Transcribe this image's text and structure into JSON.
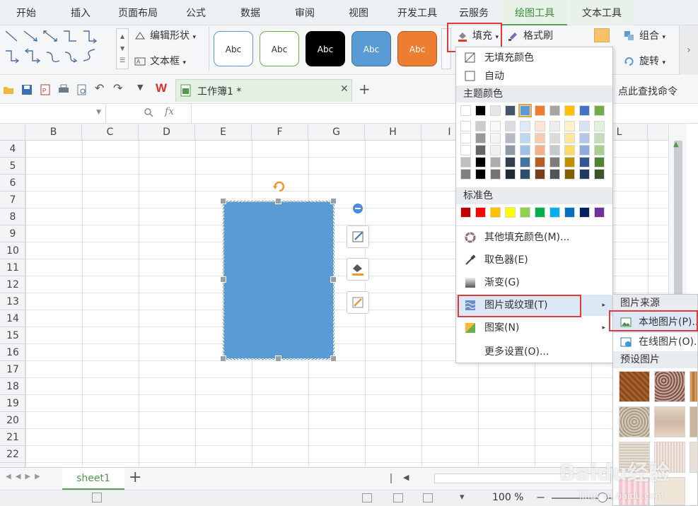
{
  "tabs": [
    "开始",
    "插入",
    "页面布局",
    "公式",
    "数据",
    "审阅",
    "视图",
    "开发工具",
    "云服务",
    "绘图工具",
    "文本工具"
  ],
  "ribbon": {
    "edit_shape": "编辑形状",
    "text_box": "文本框",
    "style_label": "Abc",
    "fill_label": "填充",
    "format_painter": "格式刷",
    "group_label": "组合",
    "rotate_label": "旋转",
    "style_colors": [
      "#ffffff",
      "#ffffff",
      "#000000",
      "#5b9bd5",
      "#ed7d31"
    ]
  },
  "toolbar": {
    "doc_title": "工作簿1 *",
    "search_cmd": "点此查找命令"
  },
  "formula": {
    "fx": "fx"
  },
  "columns": [
    "B",
    "C",
    "D",
    "E",
    "F",
    "G",
    "H",
    "I",
    "",
    "",
    "L"
  ],
  "rows": [
    "4",
    "5",
    "6",
    "7",
    "8",
    "9",
    "10",
    "11",
    "12",
    "13",
    "14",
    "15",
    "16",
    "17",
    "18",
    "19",
    "20",
    "21",
    "22"
  ],
  "shape": {
    "fill_color": "#5b9bd5"
  },
  "fill_menu": {
    "no_fill": "无填充颜色",
    "auto": "自动",
    "theme_colors_title": "主题颜色",
    "standard_colors_title": "标准色",
    "more_colors": "其他填充颜色(M)...",
    "eyedropper": "取色器(E)",
    "gradient": "渐变(G)",
    "picture_texture": "图片或纹理(T)",
    "pattern": "图案(N)",
    "more_settings": "更多设置(O)...",
    "theme_row": [
      "#ffffff",
      "#000000",
      "#e7e6e6",
      "#44546a",
      "#5b9bd5",
      "#ed7d31",
      "#a5a5a5",
      "#ffc000",
      "#4472c4",
      "#70ad47"
    ],
    "standard": [
      "#c00000",
      "#ff0000",
      "#ffc000",
      "#ffff00",
      "#92d050",
      "#00b050",
      "#00b0f0",
      "#0070c0",
      "#002060",
      "#7030a0"
    ]
  },
  "submenu": {
    "source_title": "图片来源",
    "local_picture": "本地图片(P)...",
    "online_picture": "在线图片(O)...",
    "preset_title": "预设图片"
  },
  "sheetbar": {
    "sheet_name": "sheet1",
    "add": "+"
  },
  "status": {
    "zoom": "100 %"
  },
  "watermark": {
    "brand": "Baidu经验",
    "url": "jingyan.baidu.com"
  }
}
